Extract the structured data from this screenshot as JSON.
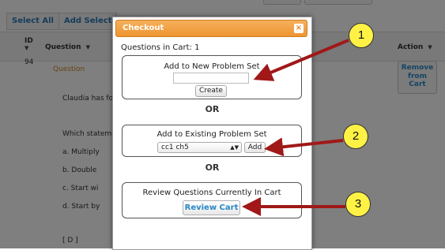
{
  "toolbar": {
    "select_all_label": "Select All",
    "add_selected_label": "Add Selected"
  },
  "table": {
    "col_id": "ID",
    "col_question": "Question",
    "col_action": "Action",
    "row": {
      "id": "94",
      "lines": [
        "Question",
        "Claudia has fou",
        "Which stateme",
        "a.      Multiply",
        "b.      Double",
        "c.      Start wi",
        "d.      Start by",
        "[ D ]"
      ],
      "remove_label": "Remove from Cart"
    }
  },
  "modal": {
    "title": "Checkout",
    "close_icon": "×",
    "cart_count": "Questions in Cart: 1",
    "new_set": {
      "title": "Add to New Problem Set",
      "input_value": "",
      "create_label": "Create"
    },
    "or_1": "OR",
    "existing_set": {
      "title": "Add to Existing Problem Set",
      "selected": "cc1 ch5",
      "add_label": "Add"
    },
    "or_2": "OR",
    "review": {
      "title": "Review Questions Currently In Cart",
      "button_label": "Review Cart"
    }
  },
  "callouts": [
    "1",
    "2",
    "3"
  ],
  "colors": {
    "header_orange": "#ee9530",
    "callout_yellow": "#fff245",
    "arrow_red": "#a01818",
    "link_blue": "#2a89c9"
  }
}
